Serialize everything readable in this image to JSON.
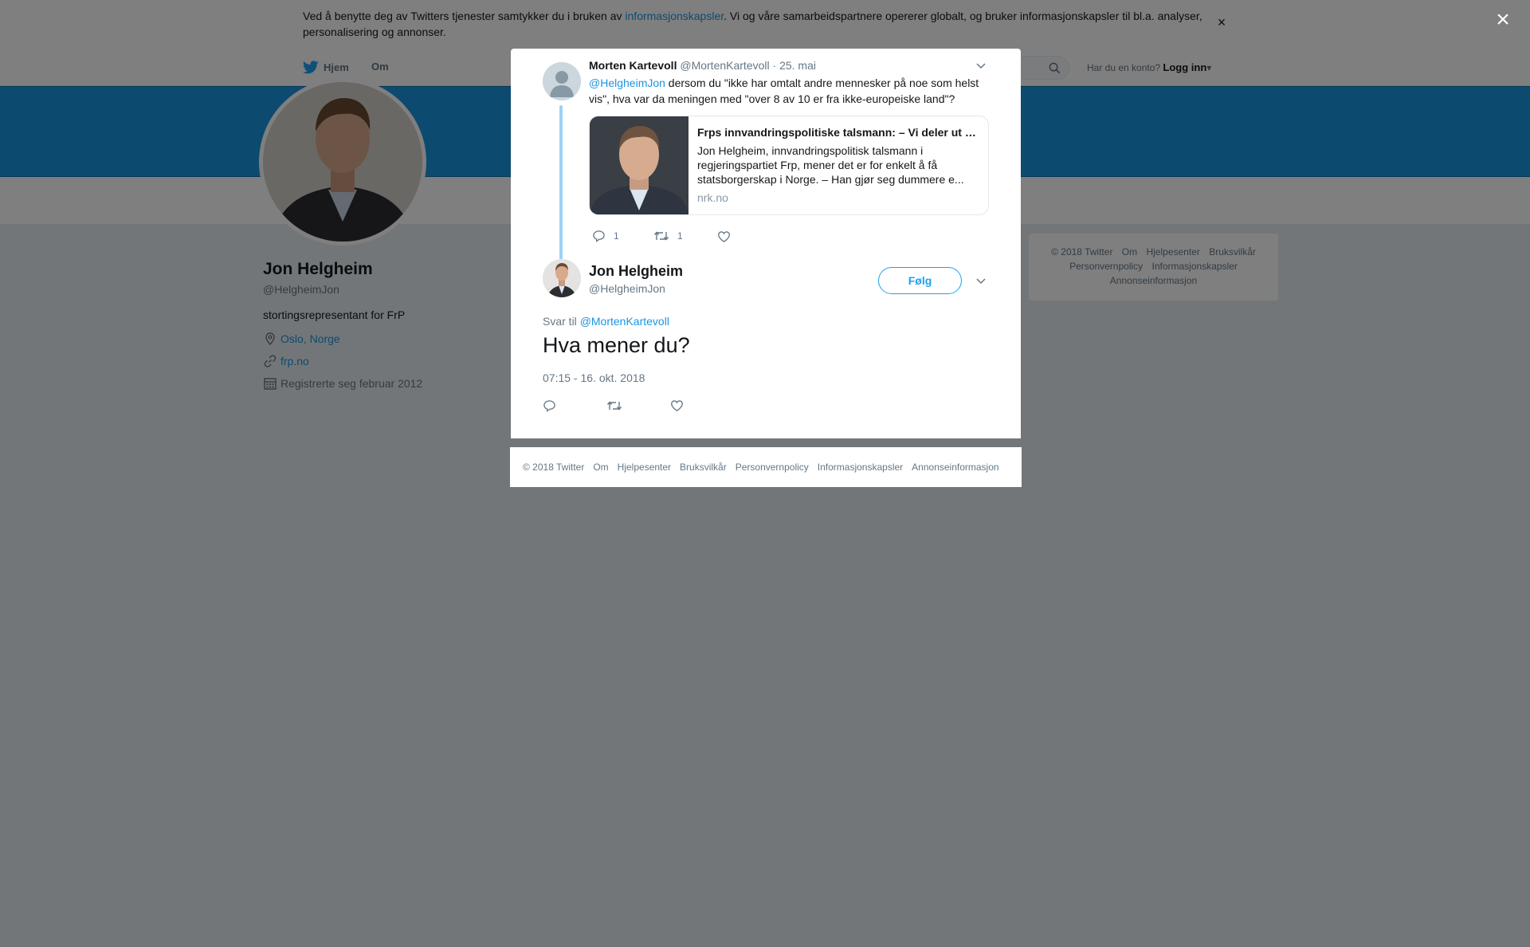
{
  "cookie_bar": {
    "text_before": "Ved å benytte deg av Twitters tjenester samtykker du i bruken av ",
    "link": "informasjonskapsler",
    "text_after": ". Vi og våre samarbeidspartnere opererer globalt, og bruker informasjonskapsler til bl.a. analyser, personalisering og annonser.",
    "close": "×"
  },
  "nav": {
    "home": "Hjem",
    "about": "Om",
    "account_question": "Har du en konto?",
    "login": "Logg inn"
  },
  "profile": {
    "name": "Jon Helgheim",
    "handle": "@HelgheimJon",
    "bio": "stortingsrepresentant for FrP",
    "location": "Oslo, Norge",
    "url": "frp.no",
    "joined": "Registrerte seg februar 2012"
  },
  "side_footer": {
    "links": [
      "© 2018 Twitter",
      "Om",
      "Hjelpesenter",
      "Bruksvilkår",
      "Personvernpolicy",
      "Informasjonskapsler",
      "Annonseinformasjon"
    ]
  },
  "overlay": {
    "close": "×"
  },
  "modal": {
    "parent_tweet": {
      "name": "Morten Kartevoll",
      "handle": "@MortenKartevoll",
      "date": "· 25. mai",
      "mention": "@HelgheimJon",
      "text": " dersom du \"ikke har omtalt andre mennesker på noe som helst vis\", hva var da meningen med \"over 8 av 10 er fra ikke-europeiske land\"?",
      "card": {
        "title": "Frps innvandringspolitiske talsmann: – Vi deler ut statsborgerskap som godteri",
        "description": "Jon Helgheim, innvandringspolitisk talsmann i regjeringspartiet Frp, mener det er for enkelt å få statsborgerskap i Norge. – Han gjør seg dummere e...",
        "domain": "nrk.no"
      },
      "replies": "1",
      "retweets": "1"
    },
    "main_tweet": {
      "name": "Jon Helgheim",
      "handle": "@HelgheimJon",
      "follow": "Følg",
      "reply_prefix": "Svar til ",
      "reply_to": "@MortenKartevoll",
      "text": "Hva mener du?",
      "timestamp": "07:15 - 16. okt. 2018"
    },
    "footer_links": [
      "© 2018 Twitter",
      "Om",
      "Hjelpesenter",
      "Bruksvilkår",
      "Personvernpolicy",
      "Informasjonskapsler",
      "Annonseinformasjon"
    ]
  },
  "colors": {
    "brand_blue": "#1da1f2",
    "link_blue": "#1b95e0",
    "banner_blue": "#1b95e0",
    "thread_line": "#9bd3f5"
  },
  "icons": [
    "twitter-bird-icon",
    "search-icon",
    "location-icon",
    "link-icon",
    "calendar-icon",
    "reply-icon",
    "retweet-icon",
    "heart-icon",
    "chevron-down-icon",
    "close-icon"
  ]
}
